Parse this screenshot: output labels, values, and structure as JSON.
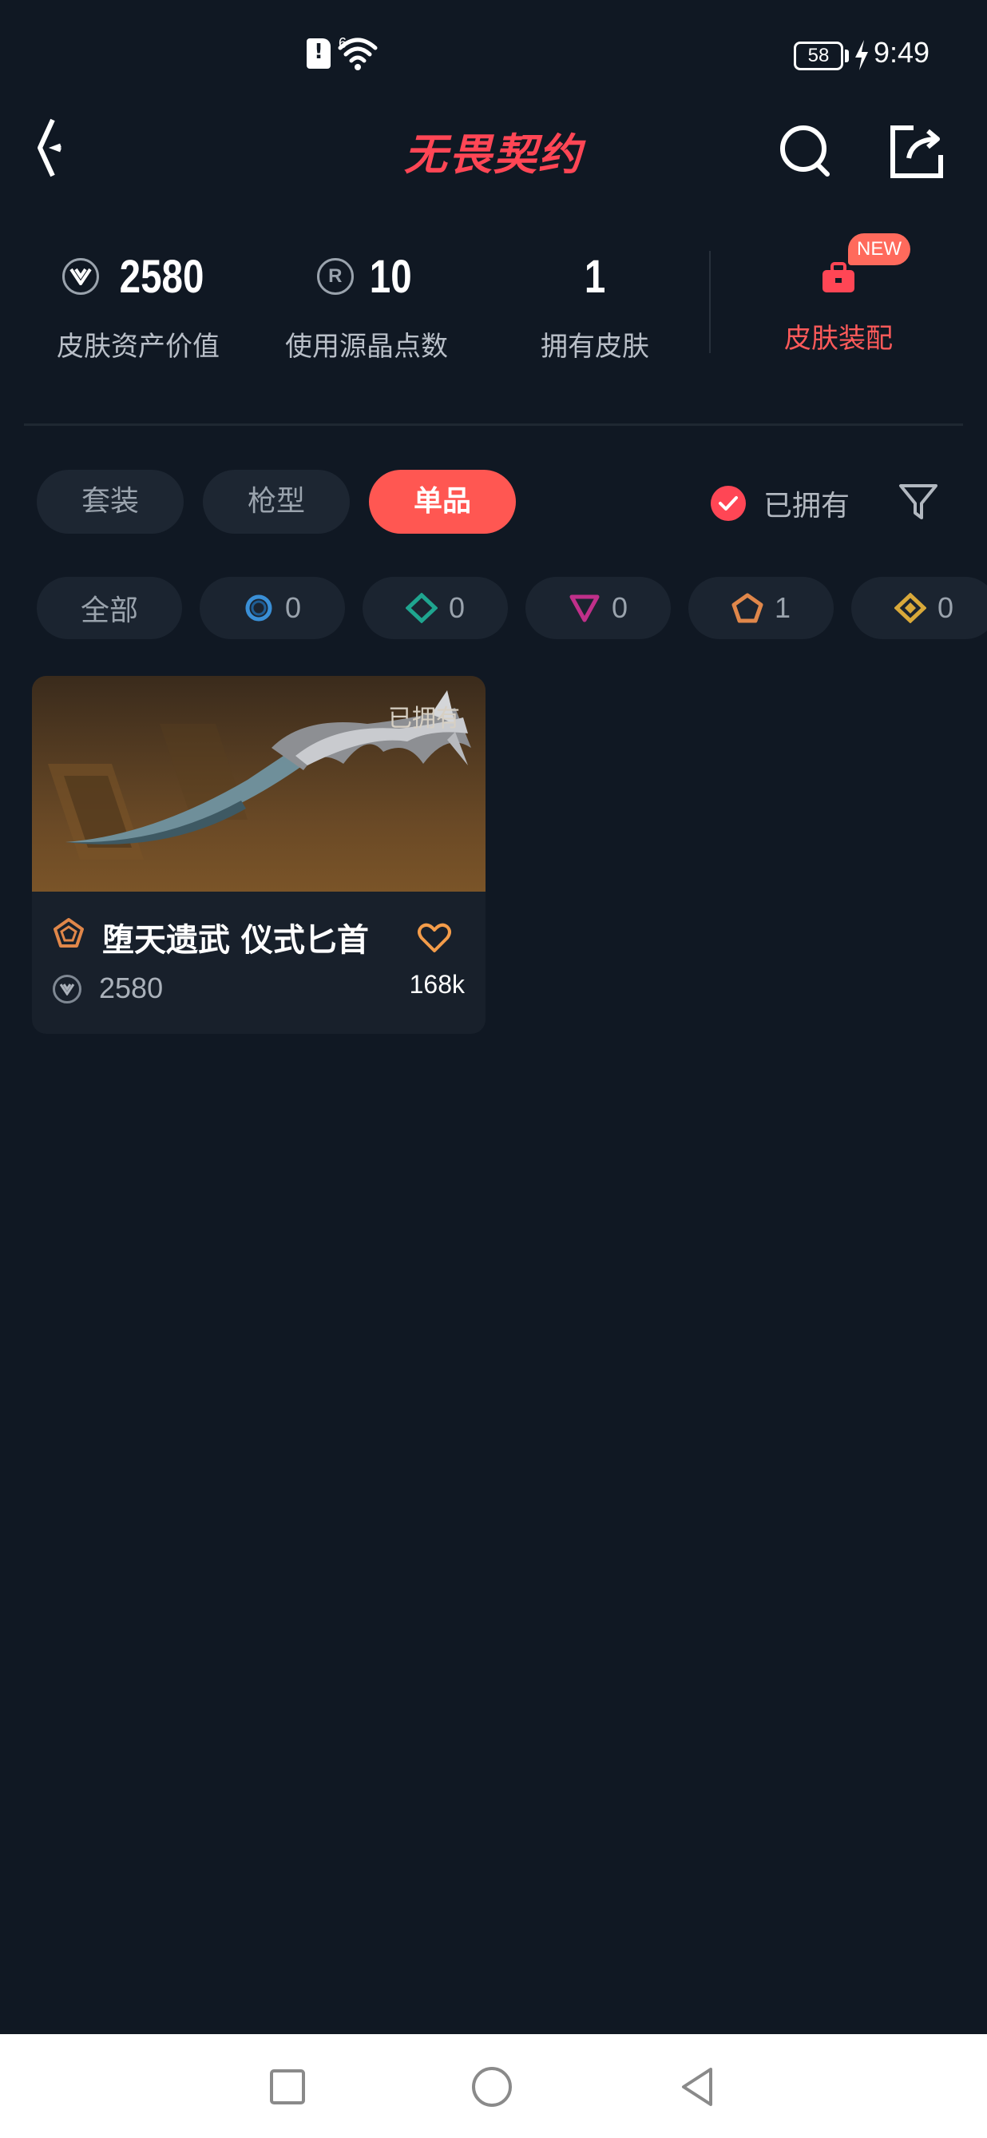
{
  "status_bar": {
    "time": "9:49",
    "battery": "58",
    "signal_badge": "6"
  },
  "header": {
    "logo": "无畏契约"
  },
  "stats": [
    {
      "value": "2580",
      "label": "皮肤资产价值",
      "icon": "vp-coin-icon"
    },
    {
      "value": "10",
      "label": "使用源晶点数",
      "icon": "radianite-icon"
    },
    {
      "value": "1",
      "label": "拥有皮肤",
      "icon": ""
    }
  ],
  "loadout": {
    "label": "皮肤装配",
    "badge": "NEW"
  },
  "tabs": [
    {
      "label": "套装",
      "active": false
    },
    {
      "label": "枪型",
      "active": false
    },
    {
      "label": "单品",
      "active": true
    }
  ],
  "owned_filter": {
    "label": "已拥有",
    "checked": true
  },
  "tiers": [
    {
      "label": "全部"
    },
    {
      "name": "select",
      "count": "0",
      "color": "#3a8fd6"
    },
    {
      "name": "deluxe",
      "count": "0",
      "color": "#1fa58f"
    },
    {
      "name": "premium",
      "count": "0",
      "color": "#c0308a"
    },
    {
      "name": "exclusive",
      "count": "1",
      "color": "#e0874a"
    },
    {
      "name": "ultra",
      "count": "0",
      "color": "#d9a93a"
    }
  ],
  "card": {
    "owned_tag": "已拥有",
    "name": "堕天遗武 仪式匕首",
    "price": "2580",
    "likes": "168k",
    "tier_color": "#e0874a"
  },
  "colors": {
    "accent": "#ff4655",
    "background": "#101823"
  }
}
